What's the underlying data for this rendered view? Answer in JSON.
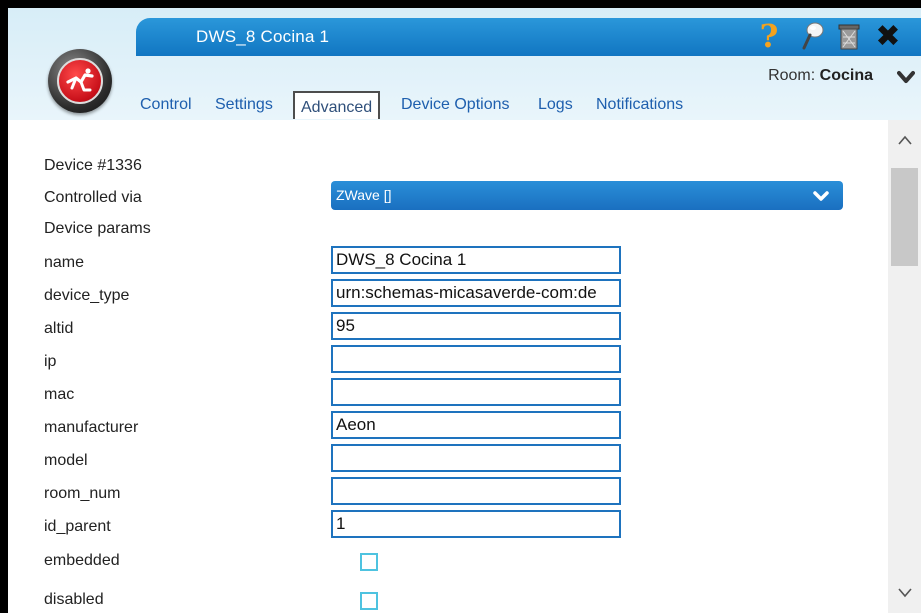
{
  "window": {
    "title": "DWS_8 Cocina 1"
  },
  "header": {
    "room_prefix": "Room: ",
    "room_name": "Cocina"
  },
  "tabs": [
    {
      "label": "Control"
    },
    {
      "label": "Settings"
    },
    {
      "label": "Advanced",
      "active": true
    },
    {
      "label": "Device Options"
    },
    {
      "label": "Logs"
    },
    {
      "label": "Notifications"
    }
  ],
  "advanced": {
    "device_number": "Device #1336",
    "controlled_via_label": "Controlled via",
    "controlled_via_value": "ZWave []",
    "device_params_label": "Device params",
    "params": [
      {
        "name": "name",
        "value": "DWS_8 Cocina 1"
      },
      {
        "name": "device_type",
        "value": "urn:schemas-micasaverde-com:de"
      },
      {
        "name": "altid",
        "value": "95"
      },
      {
        "name": "ip",
        "value": ""
      },
      {
        "name": "mac",
        "value": ""
      },
      {
        "name": "manufacturer",
        "value": "Aeon"
      },
      {
        "name": "model",
        "value": ""
      },
      {
        "name": "room_num",
        "value": ""
      },
      {
        "name": "id_parent",
        "value": "1"
      }
    ],
    "flags": [
      {
        "name": "embedded",
        "checked": false
      },
      {
        "name": "disabled",
        "checked": false
      }
    ]
  },
  "colors": {
    "title_bar": "#1a84cc",
    "tab_link": "#1e5fae",
    "field_border": "#1e73be",
    "checkbox_border": "#4ec3e0",
    "help_icon": "#f4a21e"
  },
  "icons": {
    "logo": "vera-runner-logo",
    "help": "question-mark-icon",
    "pin": "pushpin-icon",
    "trash": "trash-icon",
    "close": "close-x-icon"
  }
}
